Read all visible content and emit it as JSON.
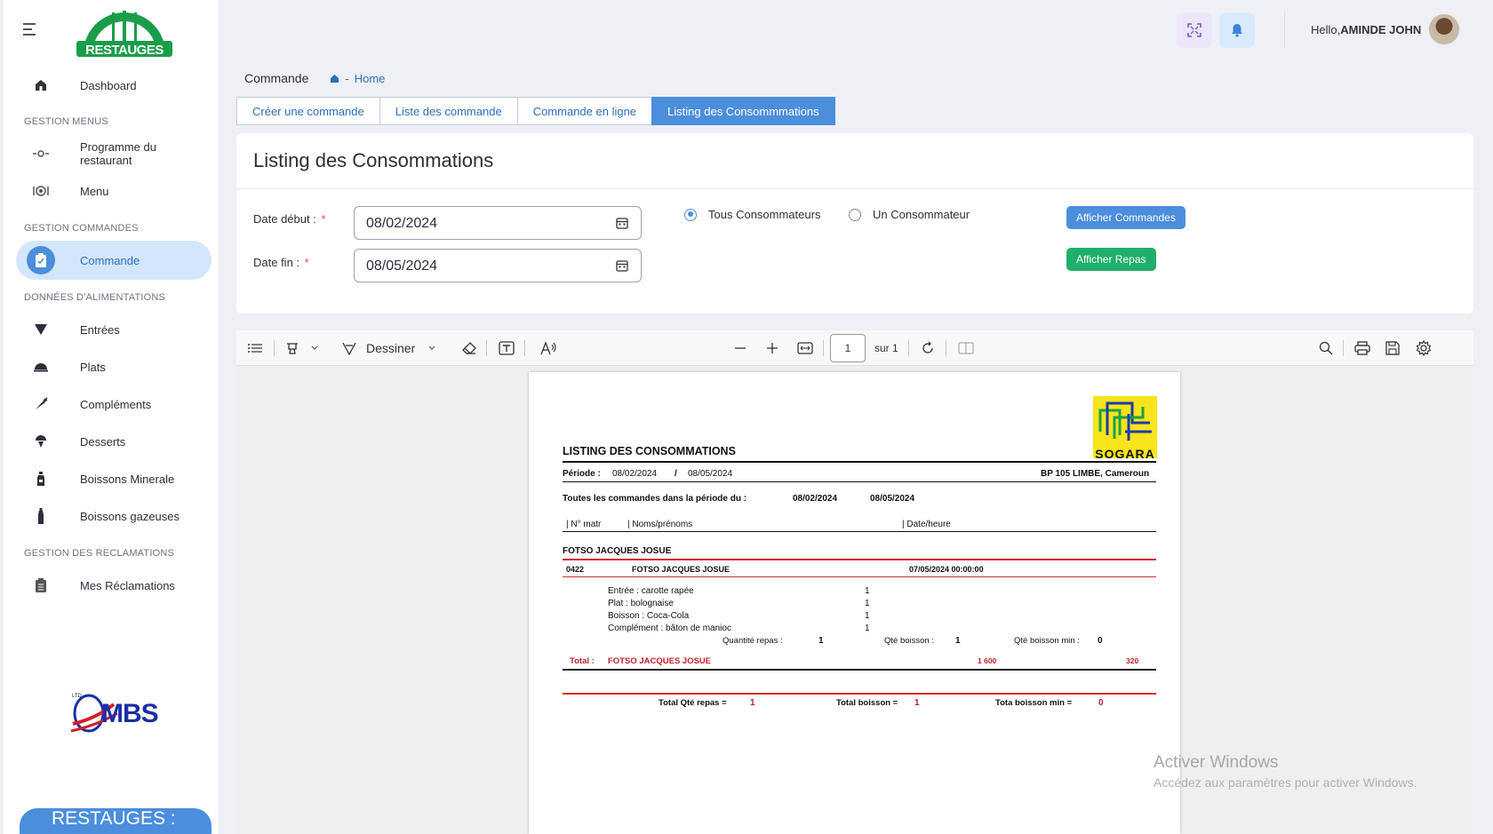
{
  "brand": {
    "logo_text": "RESTAUGES",
    "bottom_pill": "RESTAUGES :",
    "partner_logo": "MBS",
    "partner_ltd": "LTD"
  },
  "sidebar": {
    "dashboard": "Dashboard",
    "sec_menus": "GESTION MENUS",
    "programme": "Programme du restaurant",
    "menu": "Menu",
    "sec_commandes": "GESTION COMMANDES",
    "commande": "Commande",
    "sec_alimentations": "DONNÉES D'ALIMENTATIONS",
    "entrees": "Entrées",
    "plats": "Plats",
    "complements": "Compléments",
    "desserts": "Desserts",
    "boissons_minerale": "Boissons Minerale",
    "boissons_gazeuses": "Boissons gazeuses",
    "sec_reclamations": "GESTION DES RECLAMATIONS",
    "reclamations": "Mes Réclamations"
  },
  "header": {
    "hello": "Hello,",
    "user": "AMINDE JOHN"
  },
  "breadcrumb": {
    "page": "Commande",
    "home": "Home"
  },
  "tabs": [
    "Créer une commande",
    "Liste des commande",
    "Commande en ligne",
    "Listing des Consommmations"
  ],
  "form": {
    "title": "Listing des Consommations",
    "date_debut_label": "Date début :",
    "date_fin_label": "Date fin :",
    "required": "*",
    "date_debut": "08/02/2024",
    "date_fin": "08/05/2024",
    "radio_all": "Tous Consommateurs",
    "radio_one": "Un Consommateur",
    "btn_commandes": "Afficher Commandes",
    "btn_repas": "Afficher Repas"
  },
  "viewer": {
    "draw_label": "Dessiner",
    "page": "1",
    "page_of": "sur 1"
  },
  "report": {
    "logo_text": "SOGARA",
    "title": "LISTING DES CONSOMMATIONS",
    "periode_label": "Période :",
    "periode_start": "08/02/2024",
    "periode_sep": "/",
    "periode_end": "08/05/2024",
    "address": "BP 105 LIMBE, Cameroun",
    "all_orders_label": "Toutes les commandes dans la période du :",
    "all_start": "08/02/2024",
    "all_end": "08/05/2024",
    "col_matr": "| N° matr",
    "col_noms": "| Noms/prénoms",
    "col_date": "| Date/heure",
    "group_name": "FOTSO JACQUES JOSUE",
    "row_matr": "0422",
    "row_name": "FOTSO JACQUES JOSUE",
    "row_date": "07/05/2024  00:00:00",
    "items": [
      {
        "label": "Entrée : carotte rapée",
        "qty": "1"
      },
      {
        "label": "Plat : bolognaise",
        "qty": "1"
      },
      {
        "label": "Boisson : Coca-Cola",
        "qty": "1"
      },
      {
        "label": "Complément : bâton de manioc",
        "qty": "1"
      }
    ],
    "qte_repas_label": "Quantité repas :",
    "qte_repas": "1",
    "qte_boisson_label": "Qté boisson :",
    "qte_boisson": "1",
    "qte_boisson_min_label": "Qté boisson min :",
    "qte_boisson_min": "0",
    "total_label": "Total :",
    "total_name": "FOTSO JACQUES JOSUE",
    "total_amount": "1 600",
    "total_min": "320",
    "grand_repas_label": "Total Qté repas =",
    "grand_repas": "1",
    "grand_boisson_label": "Total boisson =",
    "grand_boisson": "1",
    "grand_min_label": "Tota boisson min =",
    "grand_min": "0"
  },
  "windows": {
    "line1": "Activer Windows",
    "line2": "Accédez aux paramètres pour activer Windows."
  }
}
